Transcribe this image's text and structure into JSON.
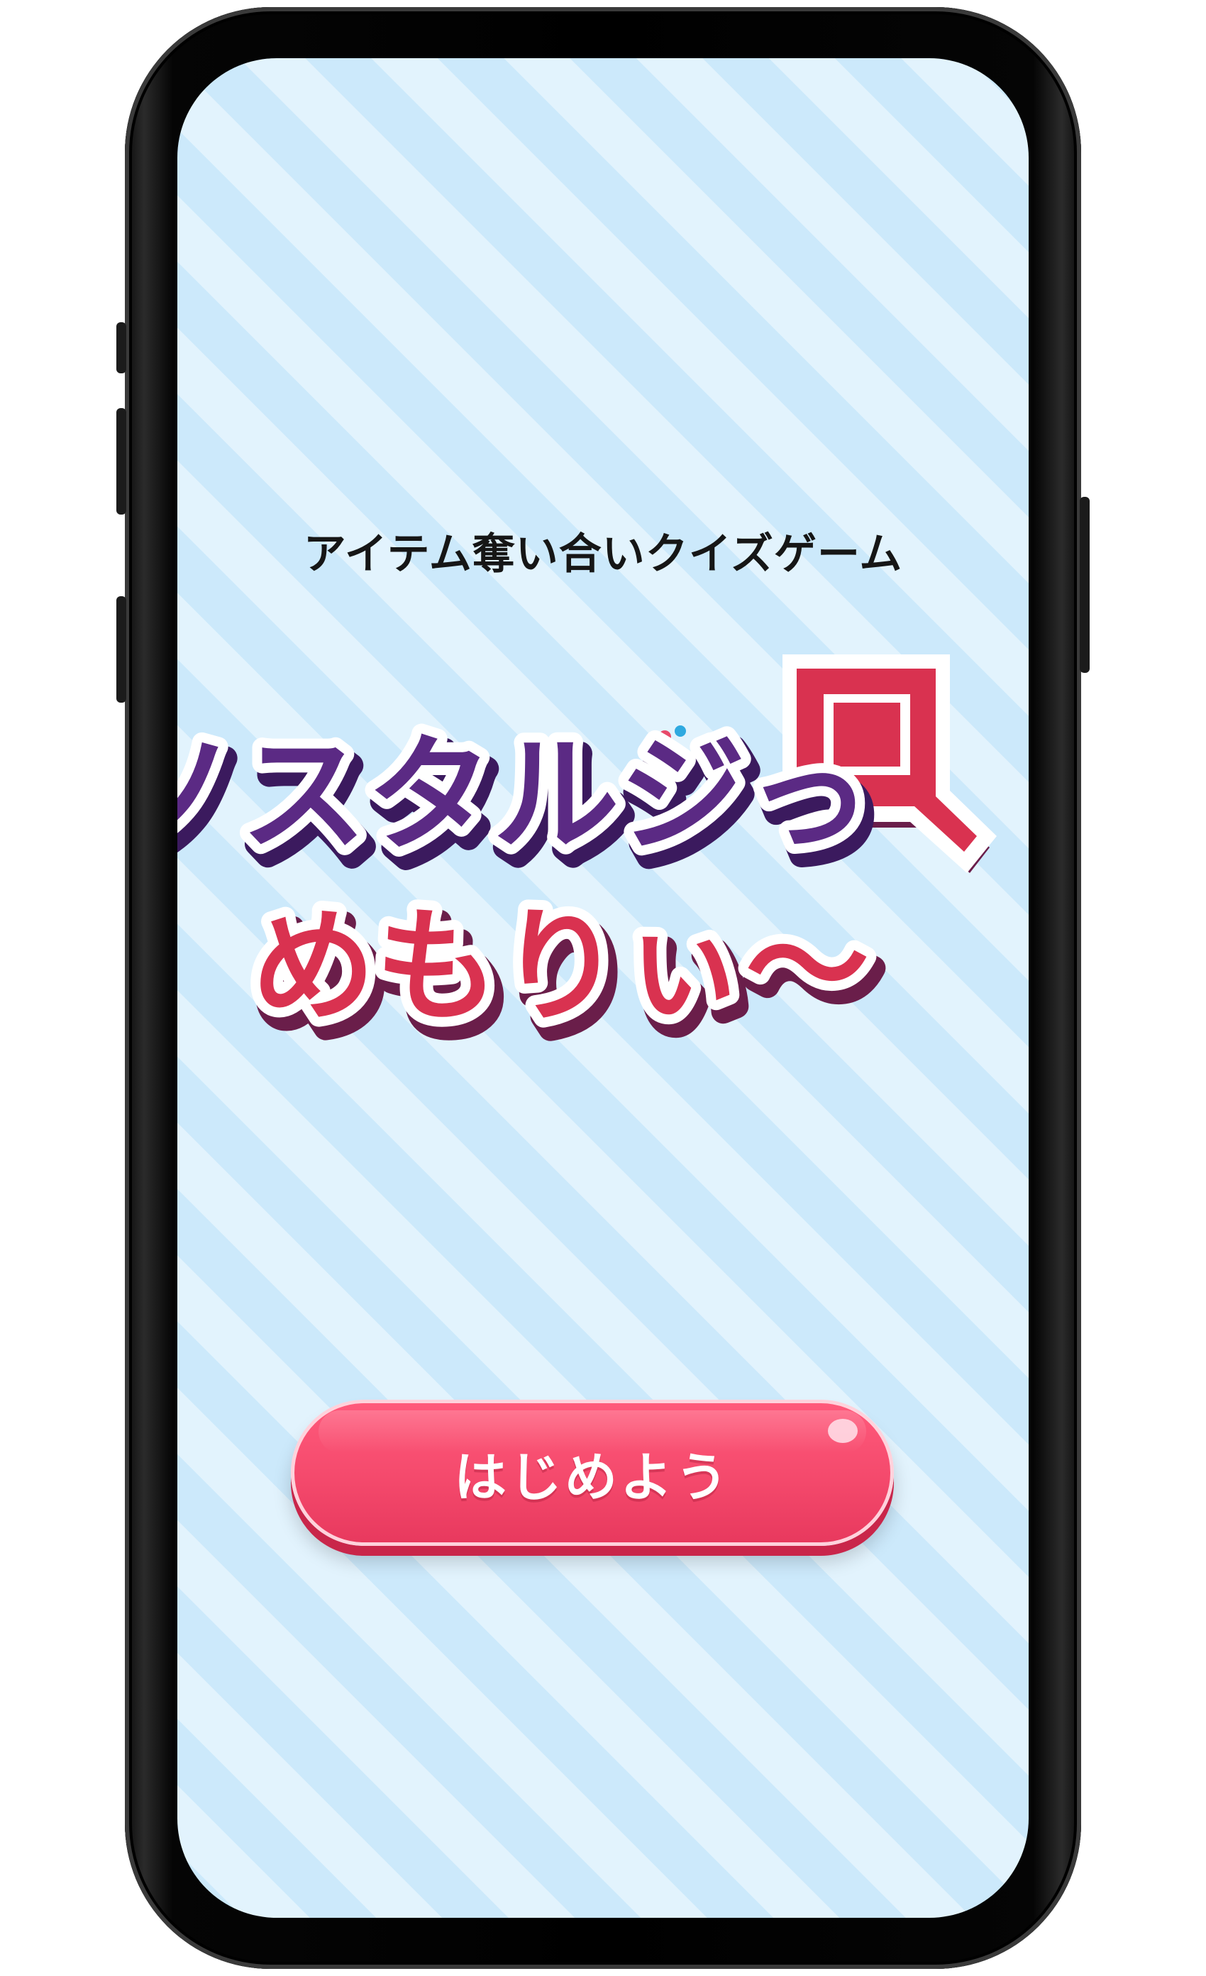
{
  "game": {
    "subtitle": "アイテム奪い合いクイズゲーム",
    "logo": {
      "line_1": "ノスタルジっ",
      "q_badge": "Q",
      "line_2": "めもりぃ〜"
    },
    "start_button_label": "はじめよう"
  },
  "colors": {
    "background_stripe_dark": "#cce9fb",
    "background_stripe_light": "#e2f3fd",
    "logo_purple": "#5b2a84",
    "logo_purple_shadow": "#3b1a5e",
    "logo_red": "#d93250",
    "logo_red_shadow": "#6a1e4a",
    "button_pink": "#f4496c",
    "text_dark": "#161616"
  }
}
